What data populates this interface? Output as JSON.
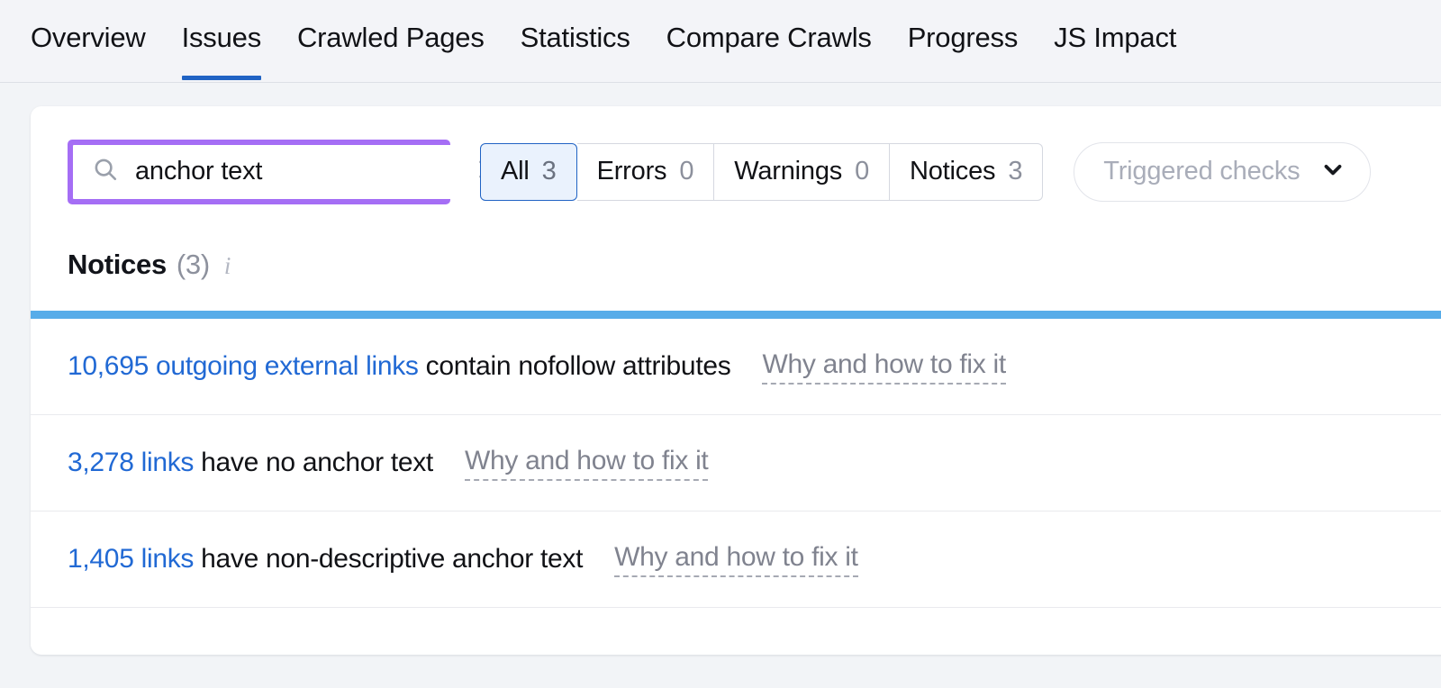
{
  "tabs": [
    {
      "label": "Overview",
      "active": false
    },
    {
      "label": "Issues",
      "active": true
    },
    {
      "label": "Crawled Pages",
      "active": false
    },
    {
      "label": "Statistics",
      "active": false
    },
    {
      "label": "Compare Crawls",
      "active": false
    },
    {
      "label": "Progress",
      "active": false
    },
    {
      "label": "JS Impact",
      "active": false
    }
  ],
  "search": {
    "value": "anchor text",
    "placeholder": "Search",
    "icon": "search-icon",
    "clear_icon": "close-icon",
    "highlight_color": "#a56ef5"
  },
  "filters": [
    {
      "label": "All",
      "count": "3",
      "selected": true
    },
    {
      "label": "Errors",
      "count": "0",
      "selected": false
    },
    {
      "label": "Warnings",
      "count": "0",
      "selected": false
    },
    {
      "label": "Notices",
      "count": "3",
      "selected": false
    }
  ],
  "dropdown": {
    "label": "Triggered checks",
    "chevron": "chevron-down-icon"
  },
  "section": {
    "title": "Notices",
    "count": "(3)",
    "info": "i",
    "accent_color": "#57ace9"
  },
  "issues": [
    {
      "metric": "10,695 outgoing external links",
      "rest": " contain nofollow attributes",
      "fix_label": "Why and how to fix it"
    },
    {
      "metric": "3,278 links",
      "rest": " have no anchor text",
      "fix_label": "Why and how to fix it"
    },
    {
      "metric": "1,405 links",
      "rest": " have non-descriptive anchor text",
      "fix_label": "Why and how to fix it"
    }
  ],
  "colors": {
    "link": "#2169d4",
    "tab_active": "#2063c4",
    "page_bg": "#f2f4f7"
  }
}
